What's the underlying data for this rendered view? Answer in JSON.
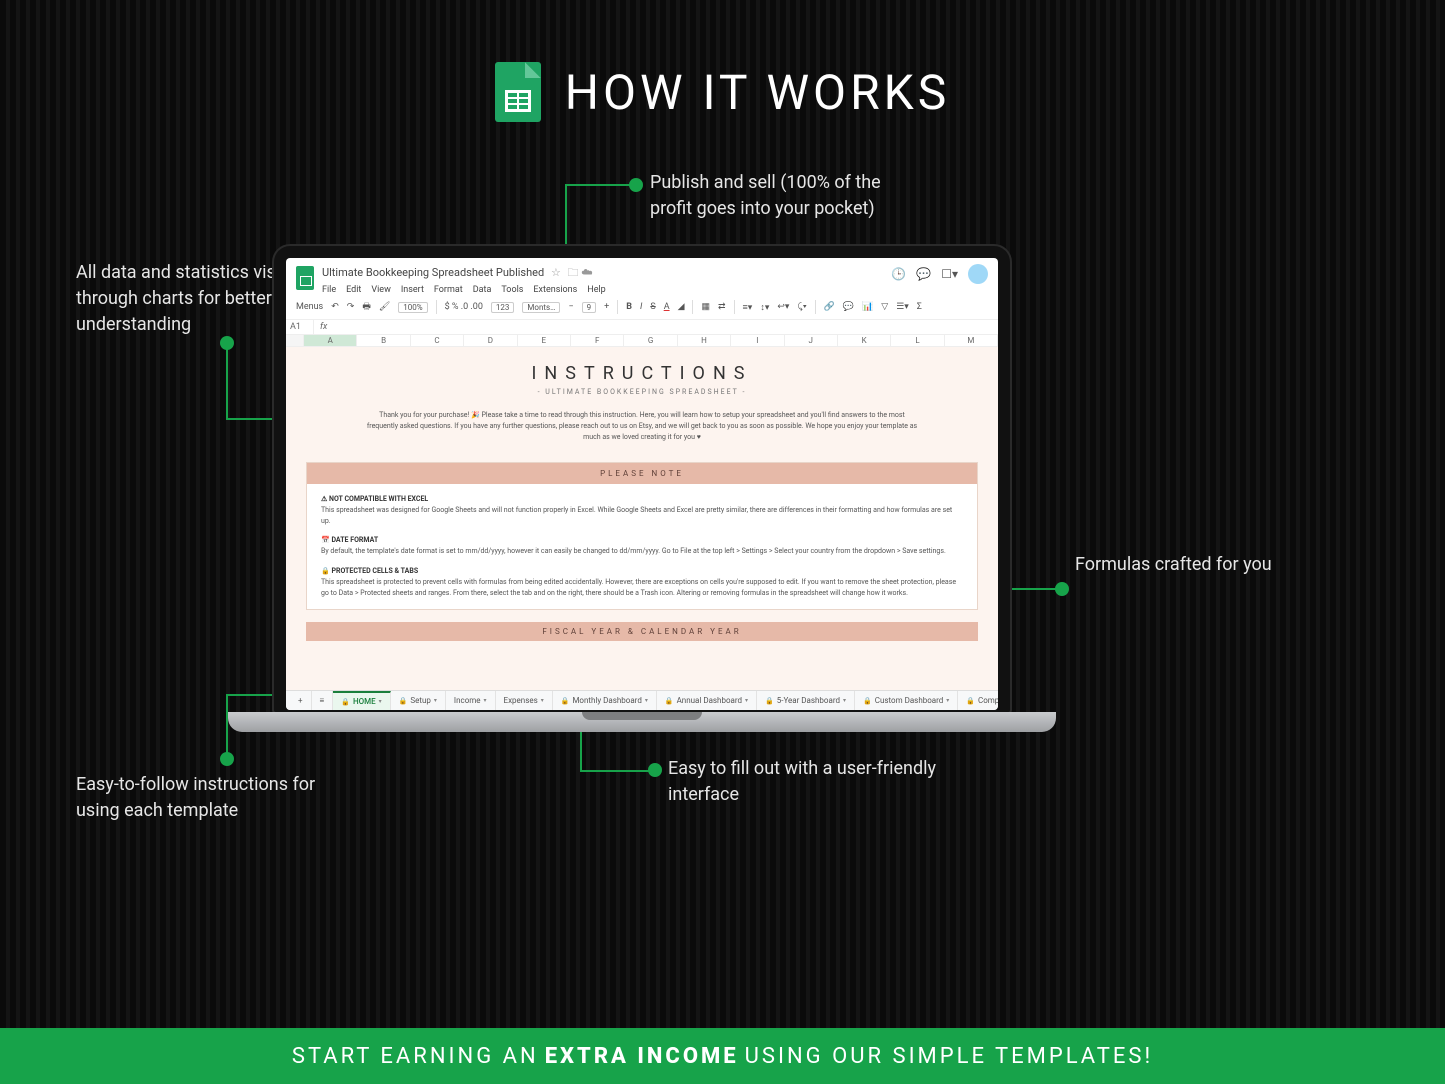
{
  "hero": {
    "title": "HOW IT WORKS"
  },
  "callouts": {
    "publish": "Publish and sell (100% of the profit goes into your pocket)",
    "charts": "All data and statistics visualized through charts for better understanding",
    "formulas": "Formulas crafted for you",
    "instructions": "Easy-to-follow instructions for using each template",
    "friendly": "Easy to fill out with a user-friendly interface"
  },
  "sheets": {
    "docname": "Ultimate Bookkeeping Spreadsheet Published",
    "menus": [
      "File",
      "Edit",
      "View",
      "Insert",
      "Format",
      "Data",
      "Tools",
      "Extensions",
      "Help"
    ],
    "toolbar_label": "Menus",
    "zoom": "100%",
    "currency": "$ % .0 .00",
    "decimals": "123",
    "font": "Monts…",
    "fontsize": "9",
    "active_cell": "A1",
    "columns": [
      "A",
      "B",
      "C",
      "D",
      "E",
      "F",
      "G",
      "H",
      "I",
      "J",
      "K",
      "L",
      "M"
    ],
    "page": {
      "title": "INSTRUCTIONS",
      "subtitle": "- ULTIMATE BOOKKEEPING SPREADSHEET -",
      "intro": "Thank you for your purchase! 🎉 Please take a time to read through this instruction. Here, you will learn how to setup your spreadsheet and you'll find answers to the most frequently asked questions. If you have any further questions, please reach out to us on Etsy, and we will get back to you as soon as possible. We hope you enjoy your template as much as we loved creating it for you ♥"
    },
    "note": {
      "header": "PLEASE NOTE",
      "s1_title": "⚠ NOT COMPATIBLE WITH EXCEL",
      "s1_body": "This spreadsheet was designed for Google Sheets and will not function properly in Excel. While Google Sheets and Excel are pretty similar, there are differences in their formatting and how formulas are set up.",
      "s2_title": "📅 DATE FORMAT",
      "s2_body": "By default, the template's date format is set to mm/dd/yyyy, however it can easily be changed to dd/mm/yyyy. Go to File at the top left > Settings > Select your country from the dropdown > Save settings.",
      "s3_title": "🔒 PROTECTED CELLS & TABS",
      "s3_body": "This spreadsheet is protected to prevent cells with formulas from being edited accidentally. However, there are exceptions on cells you're supposed to edit. If you want to remove the sheet protection, please go to Data > Protected sheets and ranges. From there, select the tab and on the right, there should be a Trash icon. Altering or removing formulas in the spreadsheet will change how it works."
    },
    "note2": "FISCAL YEAR & CALENDAR YEAR",
    "tabs": [
      "HOME",
      "Setup",
      "Income",
      "Expenses",
      "Monthly Dashboard",
      "Annual Dashboard",
      "5-Year Dashboard",
      "Custom Dashboard",
      "Comparison Dashboa"
    ]
  },
  "footer": {
    "pre": "START EARNING AN",
    "bold": "EXTRA INCOME",
    "post": "USING OUR SIMPLE TEMPLATES!"
  }
}
